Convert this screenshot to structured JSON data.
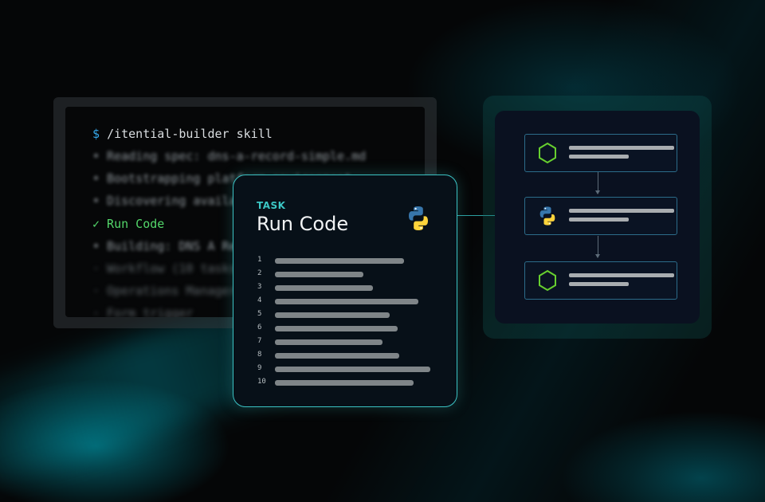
{
  "terminal": {
    "prompt": "$",
    "command": "/itential-builder skill",
    "lines": [
      {
        "text": "• Reading spec: dns-a-record-simple.md",
        "status": "blur"
      },
      {
        "text": "• Bootstrapping platform environment",
        "status": "blur"
      },
      {
        "text": "• Discovering available adapters",
        "status": "blur"
      },
      {
        "text": "✓ Run Code",
        "status": "ok"
      },
      {
        "text": "• Building: DNS A Record",
        "status": "blur"
      },
      {
        "text": "· Workflow (10 tasks)",
        "status": "faint"
      },
      {
        "text": "· Operations Manager",
        "status": "faint"
      },
      {
        "text": "· Form trigger",
        "status": "faint"
      }
    ]
  },
  "task_card": {
    "label": "TASK",
    "title": "Run Code",
    "icon": "python-icon",
    "code_lines": [
      {
        "num": "1",
        "length": 0.79
      },
      {
        "num": "2",
        "length": 0.54
      },
      {
        "num": "3",
        "length": 0.6
      },
      {
        "num": "4",
        "length": 0.88
      },
      {
        "num": "5",
        "length": 0.7
      },
      {
        "num": "6",
        "length": 0.75
      },
      {
        "num": "7",
        "length": 0.66
      },
      {
        "num": "8",
        "length": 0.76
      },
      {
        "num": "9",
        "length": 0.95
      },
      {
        "num": "10",
        "length": 0.85
      }
    ]
  },
  "workflow": {
    "nodes": [
      {
        "icon": "hexagon-icon"
      },
      {
        "icon": "python-icon"
      },
      {
        "icon": "hexagon-icon"
      }
    ]
  },
  "colors": {
    "accent": "#3bc2c3",
    "success": "#53d66a",
    "prompt": "#35a7e8",
    "python_blue": "#3776ab",
    "python_yellow": "#ffd43b",
    "hexagon": "#67cf2f"
  }
}
